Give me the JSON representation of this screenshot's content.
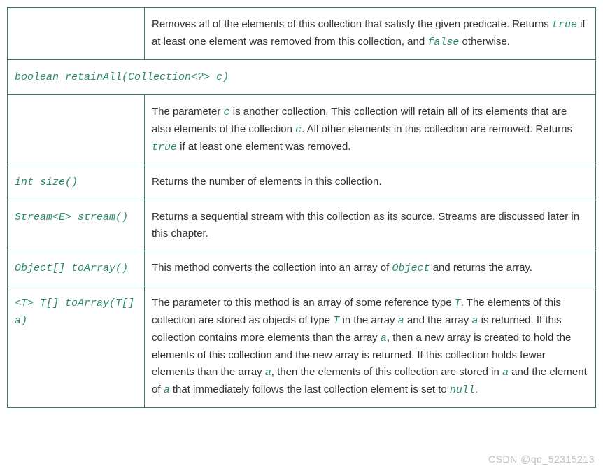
{
  "rows": [
    {
      "sig": "",
      "desc": [
        {
          "t": "Removes all of the elements of this collection that satisfy the given predicate. Returns "
        },
        {
          "c": "true"
        },
        {
          "t": " if at least one element was removed from this collection, and "
        },
        {
          "c": "false"
        },
        {
          "t": " otherwise."
        }
      ]
    },
    {
      "full_sig": "boolean retainAll(Collection<?> c)"
    },
    {
      "sig": "",
      "desc": [
        {
          "t": "The parameter "
        },
        {
          "c": "c"
        },
        {
          "t": " is another collection. This collection will retain all of its elements that are also elements of the collection "
        },
        {
          "c": "c"
        },
        {
          "t": ". All other elements in this collection are removed. Returns "
        },
        {
          "c": "true"
        },
        {
          "t": " if at least one element was removed."
        }
      ]
    },
    {
      "sig": "int size()",
      "desc": [
        {
          "t": "Returns the number of elements in this collection."
        }
      ]
    },
    {
      "sig": "Stream<E> stream()",
      "desc": [
        {
          "t": "Returns a sequential stream with this collection as its source. Streams are discussed later in this chapter."
        }
      ]
    },
    {
      "sig": "Object[] toArray()",
      "desc": [
        {
          "t": "This method converts the collection into an array of "
        },
        {
          "c": "Object"
        },
        {
          "t": " and returns the array."
        }
      ]
    },
    {
      "sig": "<T> T[] toArray(T[] a)",
      "desc": [
        {
          "t": "The parameter to this method is an array of some reference type "
        },
        {
          "c": "T"
        },
        {
          "t": ". The elements of this collection are stored as objects of type "
        },
        {
          "c": "T"
        },
        {
          "t": " in the array "
        },
        {
          "c": "a"
        },
        {
          "t": " and the array "
        },
        {
          "c": "a"
        },
        {
          "t": " is returned. If this collection contains more elements than the array "
        },
        {
          "c": "a"
        },
        {
          "t": ", then a new array is created to hold the elements of this collection and the new array is returned. If this collection holds fewer elements than the array "
        },
        {
          "c": "a"
        },
        {
          "t": ", then the elements of this collection are stored in "
        },
        {
          "c": "a"
        },
        {
          "t": " and the element of "
        },
        {
          "c": "a"
        },
        {
          "t": " that immediately follows the last collection element is set to "
        },
        {
          "c": "null"
        },
        {
          "t": "."
        }
      ]
    }
  ],
  "watermark": "CSDN @qq_52315213"
}
